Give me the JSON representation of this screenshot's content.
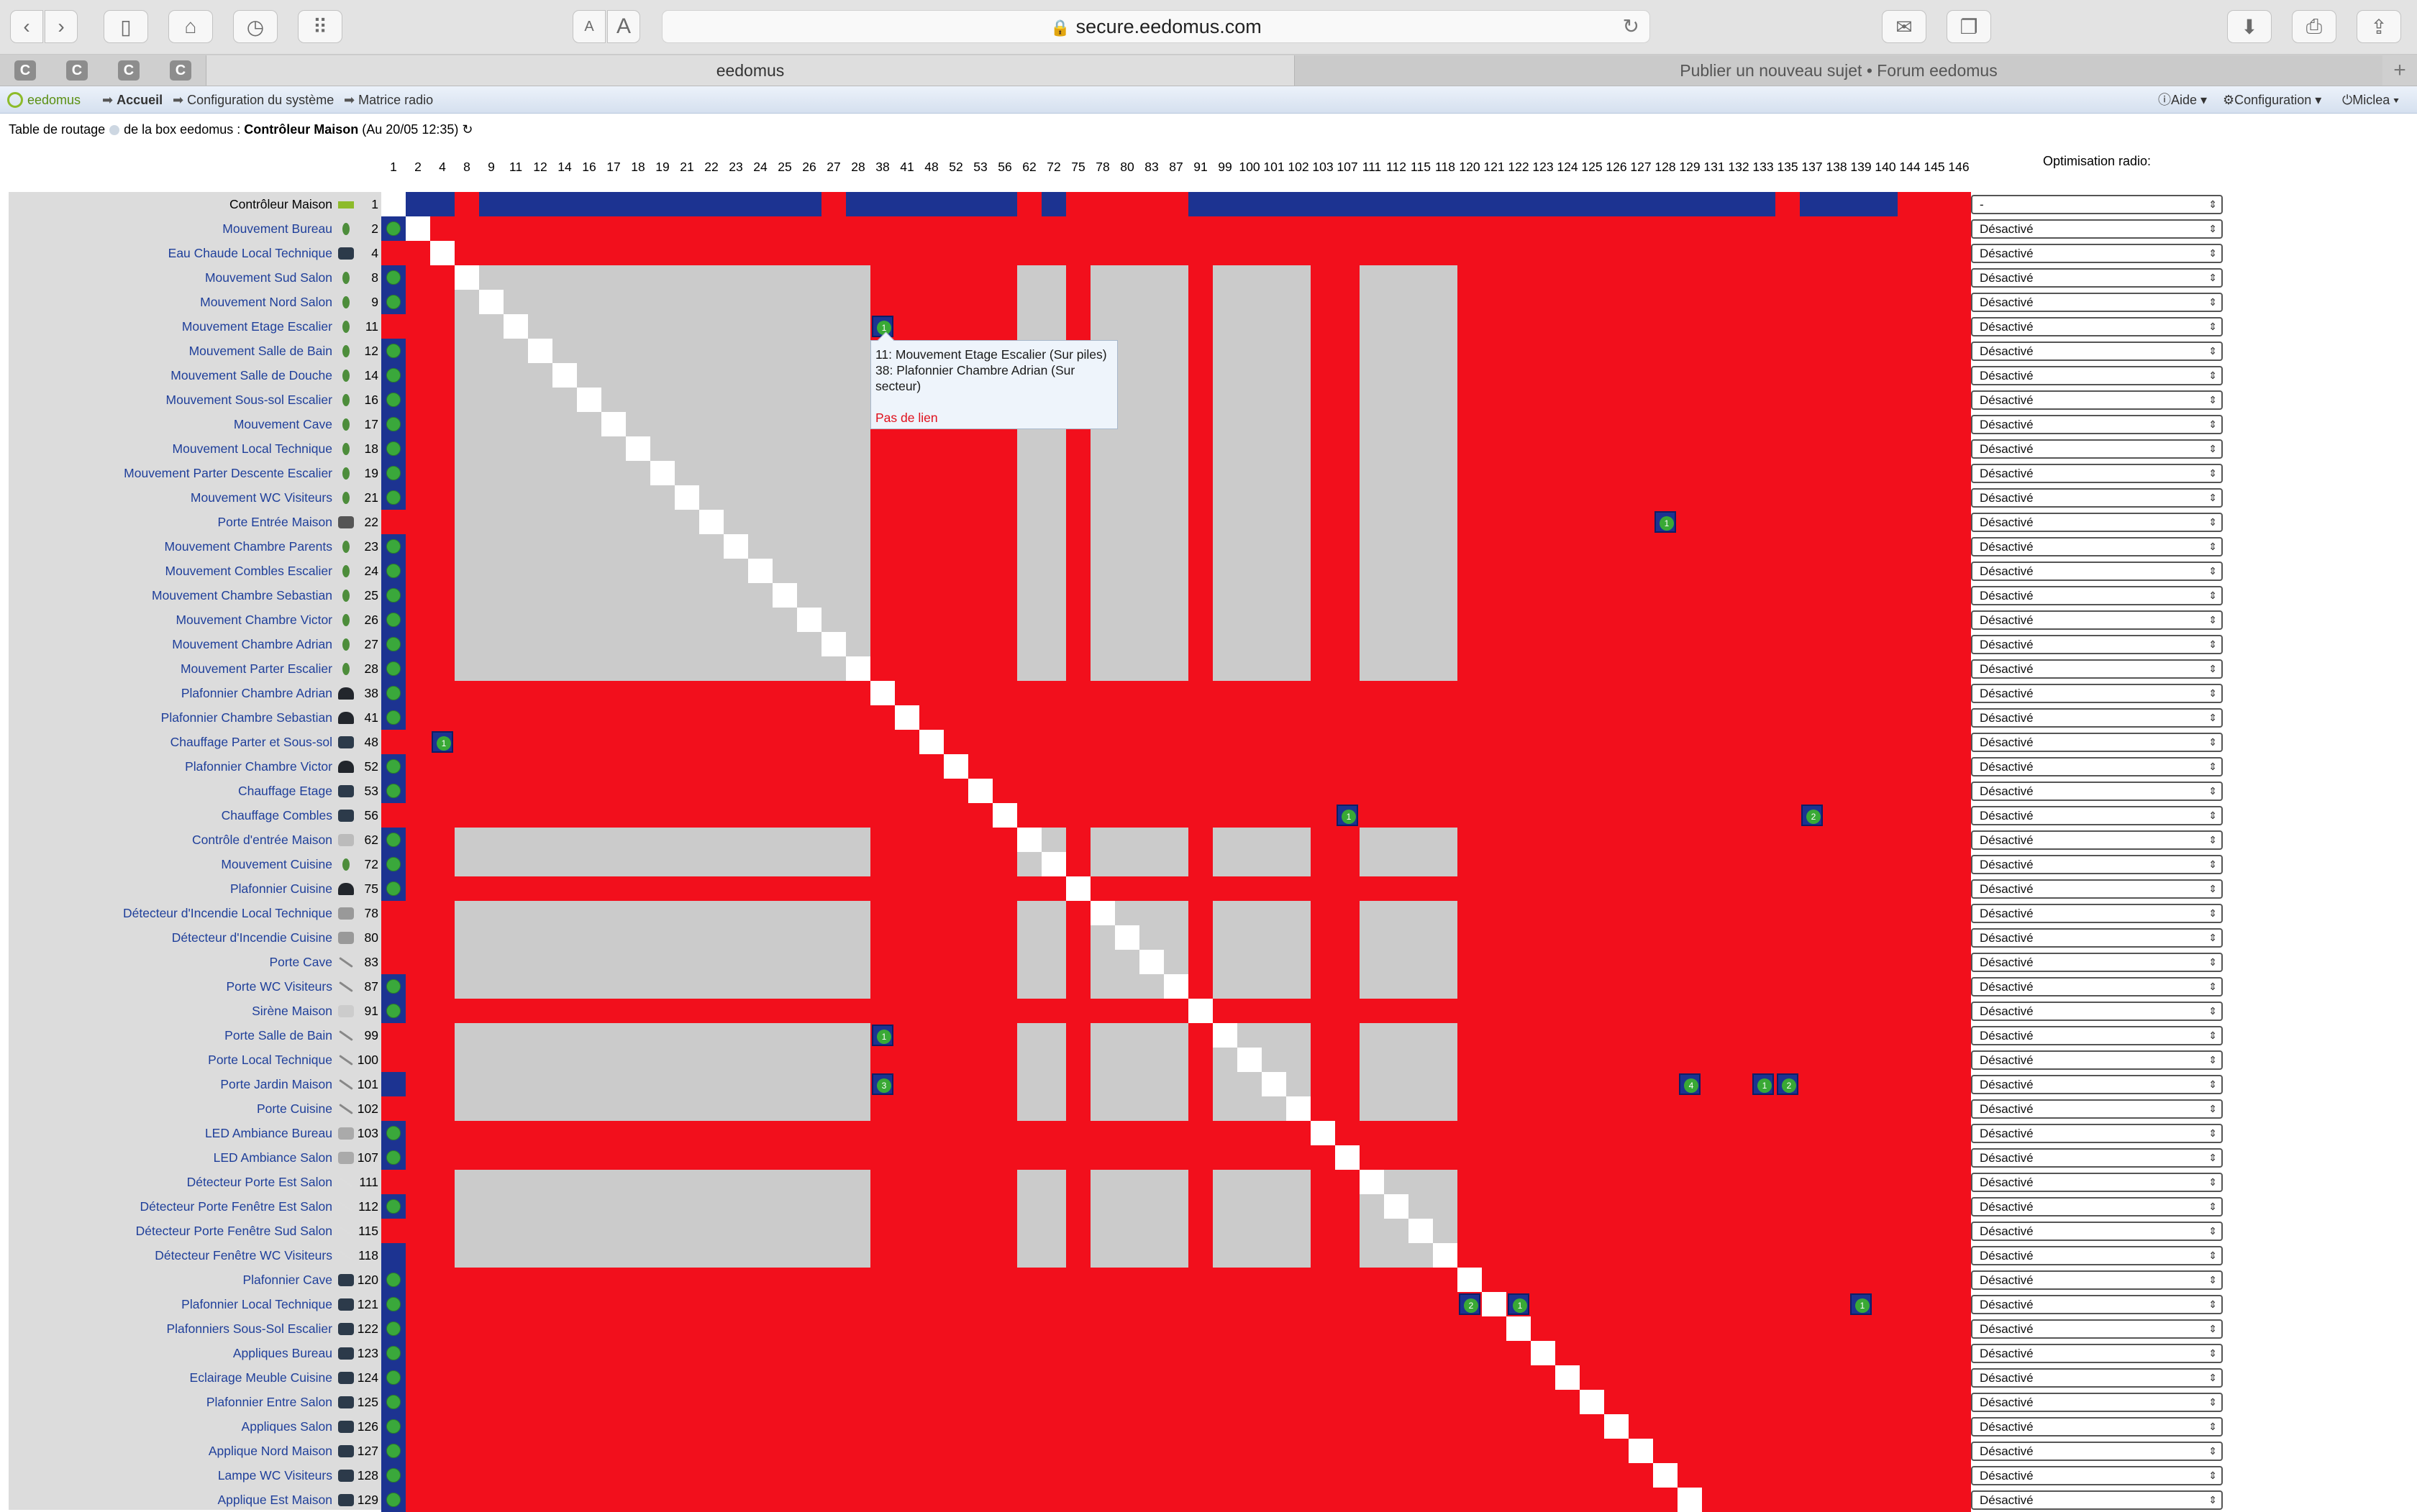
{
  "browser": {
    "url": "secure.eedomus.com",
    "tabs": [
      "eedomus",
      "Publier un nouveau sujet • Forum eedomus"
    ],
    "collapsed_tab_letter": "C",
    "text_small": "A",
    "text_large": "A"
  },
  "nav": {
    "brand": "eedomus",
    "items": [
      "Accueil",
      "Configuration du système",
      "Matrice radio"
    ],
    "right": [
      "Aide",
      "Configuration",
      "Miclea"
    ]
  },
  "subtitle": {
    "prefix": "Table de routage",
    "middle": "de la box eedomus :",
    "controller": "Contrôleur Maison",
    "date": "(Au 20/05 12:35)"
  },
  "columns": [
    "1",
    "2",
    "4",
    "8",
    "9",
    "11",
    "12",
    "14",
    "16",
    "17",
    "18",
    "19",
    "21",
    "22",
    "23",
    "24",
    "25",
    "26",
    "27",
    "28",
    "38",
    "41",
    "48",
    "52",
    "53",
    "56",
    "62",
    "72",
    "75",
    "78",
    "80",
    "83",
    "87",
    "91",
    "99",
    "100",
    "101",
    "102",
    "103",
    "107",
    "111",
    "112",
    "115",
    "118",
    "120",
    "121",
    "122",
    "123",
    "124",
    "125",
    "126",
    "127",
    "128",
    "129",
    "131",
    "132",
    "133",
    "135",
    "137",
    "138",
    "139",
    "140",
    "144",
    "145",
    "146"
  ],
  "optimisation_label": "Optimisation radio:",
  "controller_row": {
    "name": "Contrôleur Maison",
    "id": "1",
    "select": "-"
  },
  "rows": [
    {
      "name": "Mouvement Bureau",
      "id": "2",
      "icon": "motion"
    },
    {
      "name": "Eau Chaude Local Technique",
      "id": "4",
      "icon": "plug"
    },
    {
      "name": "Mouvement Sud Salon",
      "id": "8",
      "icon": "motion"
    },
    {
      "name": "Mouvement Nord Salon",
      "id": "9",
      "icon": "motion"
    },
    {
      "name": "Mouvement Etage Escalier",
      "id": "11",
      "icon": "motion"
    },
    {
      "name": "Mouvement Salle de Bain",
      "id": "12",
      "icon": "motion"
    },
    {
      "name": "Mouvement Salle de Douche",
      "id": "14",
      "icon": "motion"
    },
    {
      "name": "Mouvement Sous-sol Escalier",
      "id": "16",
      "icon": "motion"
    },
    {
      "name": "Mouvement Cave",
      "id": "17",
      "icon": "motion"
    },
    {
      "name": "Mouvement Local Technique",
      "id": "18",
      "icon": "motion"
    },
    {
      "name": "Mouvement Parter Descente Escalier",
      "id": "19",
      "icon": "motion"
    },
    {
      "name": "Mouvement WC Visiteurs",
      "id": "21",
      "icon": "motion"
    },
    {
      "name": "Porte Entrée Maison",
      "id": "22",
      "icon": "door"
    },
    {
      "name": "Mouvement Chambre Parents",
      "id": "23",
      "icon": "motion"
    },
    {
      "name": "Mouvement Combles Escalier",
      "id": "24",
      "icon": "motion"
    },
    {
      "name": "Mouvement Chambre Sebastian",
      "id": "25",
      "icon": "motion"
    },
    {
      "name": "Mouvement Chambre Victor",
      "id": "26",
      "icon": "motion"
    },
    {
      "name": "Mouvement Chambre Adrian",
      "id": "27",
      "icon": "motion"
    },
    {
      "name": "Mouvement Parter Escalier",
      "id": "28",
      "icon": "motion"
    },
    {
      "name": "Plafonnier Chambre Adrian",
      "id": "38",
      "icon": "lamp"
    },
    {
      "name": "Plafonnier Chambre Sebastian",
      "id": "41",
      "icon": "lamp"
    },
    {
      "name": "Chauffage Parter et Sous-sol",
      "id": "48",
      "icon": "plug"
    },
    {
      "name": "Plafonnier Chambre Victor",
      "id": "52",
      "icon": "lamp"
    },
    {
      "name": "Chauffage Etage",
      "id": "53",
      "icon": "plug"
    },
    {
      "name": "Chauffage Combles",
      "id": "56",
      "icon": "plug"
    },
    {
      "name": "Contrôle d'entrée Maison",
      "id": "62",
      "icon": "keypad"
    },
    {
      "name": "Mouvement Cuisine",
      "id": "72",
      "icon": "motion"
    },
    {
      "name": "Plafonnier Cuisine",
      "id": "75",
      "icon": "lamp"
    },
    {
      "name": "Détecteur d'Incendie Local Technique",
      "id": "78",
      "icon": "smoke"
    },
    {
      "name": "Détecteur d'Incendie Cuisine",
      "id": "80",
      "icon": "smoke"
    },
    {
      "name": "Porte Cave",
      "id": "83",
      "icon": "contact"
    },
    {
      "name": "Porte WC Visiteurs",
      "id": "87",
      "icon": "contact"
    },
    {
      "name": "Sirène Maison",
      "id": "91",
      "icon": "siren"
    },
    {
      "name": "Porte Salle de Bain",
      "id": "99",
      "icon": "contact"
    },
    {
      "name": "Porte Local Technique",
      "id": "100",
      "icon": "contact"
    },
    {
      "name": "Porte Jardin Maison",
      "id": "101",
      "icon": "contact"
    },
    {
      "name": "Porte Cuisine",
      "id": "102",
      "icon": "contact"
    },
    {
      "name": "LED Ambiance Bureau",
      "id": "103",
      "icon": "led"
    },
    {
      "name": "LED Ambiance Salon",
      "id": "107",
      "icon": "led"
    },
    {
      "name": "Détecteur Porte Est Salon",
      "id": "111",
      "icon": "sensor"
    },
    {
      "name": "Détecteur Porte Fenêtre Est Salon",
      "id": "112",
      "icon": "sensor"
    },
    {
      "name": "Détecteur Porte Fenêtre Sud Salon",
      "id": "115",
      "icon": "sensor"
    },
    {
      "name": "Détecteur Fenêtre WC Visiteurs",
      "id": "118",
      "icon": "sensor"
    },
    {
      "name": "Plafonnier Cave",
      "id": "120",
      "icon": "plug"
    },
    {
      "name": "Plafonnier Local Technique",
      "id": "121",
      "icon": "plug"
    },
    {
      "name": "Plafonniers Sous-Sol Escalier",
      "id": "122",
      "icon": "plug"
    },
    {
      "name": "Appliques Bureau",
      "id": "123",
      "icon": "plug"
    },
    {
      "name": "Eclairage Meuble Cuisine",
      "id": "124",
      "icon": "plug"
    },
    {
      "name": "Plafonnier Entre Salon",
      "id": "125",
      "icon": "plug"
    },
    {
      "name": "Appliques Salon",
      "id": "126",
      "icon": "plug"
    },
    {
      "name": "Applique Nord Maison",
      "id": "127",
      "icon": "plug"
    },
    {
      "name": "Lampe WC Visiteurs",
      "id": "128",
      "icon": "plug"
    },
    {
      "name": "Applique Est Maison",
      "id": "129",
      "icon": "plug"
    }
  ],
  "row_option": "Désactivé",
  "badges": [
    {
      "row": "11",
      "col": "38",
      "label": "1"
    },
    {
      "row": "22",
      "col": "128",
      "label": "1"
    },
    {
      "row": "48",
      "col": "4",
      "label": "1"
    },
    {
      "row": "56",
      "col": "107",
      "label": "1"
    },
    {
      "row": "56",
      "col": "137",
      "label": "2"
    },
    {
      "row": "99",
      "col": "38",
      "label": "1"
    },
    {
      "row": "101",
      "col": "38",
      "label": "3"
    },
    {
      "row": "101",
      "col": "129",
      "label": "4"
    },
    {
      "row": "101",
      "col": "133",
      "label": "1"
    },
    {
      "row": "101",
      "col": "135",
      "label": "2"
    },
    {
      "row": "121",
      "col": "120",
      "label": "2"
    },
    {
      "row": "121",
      "col": "122",
      "label": "1"
    },
    {
      "row": "121",
      "col": "139",
      "label": "1"
    }
  ],
  "tooltip": {
    "line1": "11: Mouvement Etage Escalier (Sur piles)",
    "line2": "38: Plafonnier Chambre Adrian (Sur secteur)",
    "status": "Pas de lien"
  },
  "colors": {
    "link_ok": "#1c3391",
    "no_link": "#f20f1c",
    "battery": "#cbcbcb",
    "diag": "#ffffff",
    "node_dot": "#3aa83b"
  }
}
